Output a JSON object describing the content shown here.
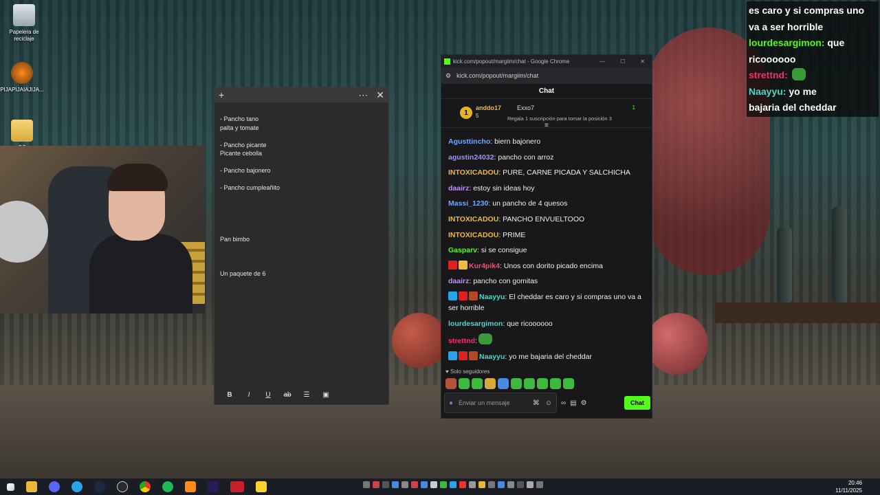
{
  "desktop": {
    "icons": [
      {
        "label": "Papelera de reciclaje"
      },
      {
        "label": "PIJAPIJAIAJIJA..."
      },
      {
        "label": "CC"
      }
    ]
  },
  "notes": {
    "lines": [
      "- Pancho tano",
      "palta y tomate",
      "",
      "- Pancho picante",
      "Picante cebolla",
      "",
      "- Pancho bajonero",
      "",
      "- Pancho cumpleañito",
      "",
      "",
      "",
      "",
      "",
      "Pan bimbo",
      "",
      "",
      "",
      "Un paquete de 6"
    ],
    "toolbar": [
      "B",
      "I",
      "U",
      "ab",
      "list",
      "image"
    ]
  },
  "chat_window": {
    "title": "kick.com/popout/margiim/chat - Google Chrome",
    "url": "kick.com/popout/margiim/chat",
    "header": "Chat",
    "pinned": {
      "rank": "1",
      "user": "anddo17",
      "count": "5",
      "top_user": "Exxo7",
      "subs": "1",
      "info": "Regala 1 suscripción para tomar la posición 3"
    },
    "messages": [
      {
        "user": "Agusttincho",
        "color": "#6fa8ff",
        "text": " biern bajonero"
      },
      {
        "user": "agustin24032",
        "color": "#a98cff",
        "text": " pancho con arroz"
      },
      {
        "user": "INTOXICADOU",
        "color": "#f2b93b",
        "text": " PURE, CARNE PICADA Y SALCHICHA"
      },
      {
        "user": "daairz",
        "color": "#c58cff",
        "text": " estoy sin ideas hoy"
      },
      {
        "user": "Massi_1230",
        "color": "#6fa8ff",
        "text": " un pancho de 4 quesos"
      },
      {
        "user": "INTOXICADOU",
        "color": "#f2b93b",
        "text": " PANCHO ENVUELTOOO"
      },
      {
        "user": "INTOXICADOU",
        "color": "#f2b93b",
        "text": " PRIME"
      },
      {
        "user": "Gasparv",
        "color": "#53fc18",
        "text": " si se consigue"
      },
      {
        "user": "Kur4pik4",
        "color": "#ff4a6e",
        "text": " Unos con dorito picado encima",
        "badges": [
          "#e02020",
          "#f2b93b"
        ]
      },
      {
        "user": "daairz",
        "color": "#c58cff",
        "text": " pancho con gomitas"
      },
      {
        "user": "Naayyu",
        "color": "#4ad9c9",
        "text": " El cheddar es caro y si compras uno va a ser horrible",
        "badges": [
          "#2aa3e8",
          "#e02020",
          "#b04a2a"
        ]
      },
      {
        "user": "lourdesargimon",
        "color": "#4ad9c9",
        "text": " que ricoooooo"
      },
      {
        "user": "strettnd",
        "color": "#ff2a6e",
        "text": "",
        "emote": "#3a9a3a"
      },
      {
        "user": "Naayyu",
        "color": "#4ad9c9",
        "text": " yo me bajaria del cheddar",
        "badges": [
          "#2aa3e8",
          "#e02020",
          "#b04a2a"
        ]
      }
    ],
    "followers_label": "Solo seguidores",
    "input_placeholder": "Enviar un mensaje",
    "chat_button": "Chat"
  },
  "overlay": {
    "lines": [
      {
        "user": "",
        "text": "es caro y si compras uno"
      },
      {
        "user": "",
        "text": "va a ser horrible"
      },
      {
        "user": "lourdesargimon:",
        "text": " que"
      },
      {
        "user": "",
        "text": "ricoooooo"
      },
      {
        "user": "strettnd:",
        "text": ""
      },
      {
        "user": "Naayyu:",
        "text": " yo me"
      },
      {
        "user": "",
        "text": "bajaria del cheddar"
      }
    ]
  },
  "taskbar": {
    "time": "20:46",
    "date": "11/11/2025"
  }
}
